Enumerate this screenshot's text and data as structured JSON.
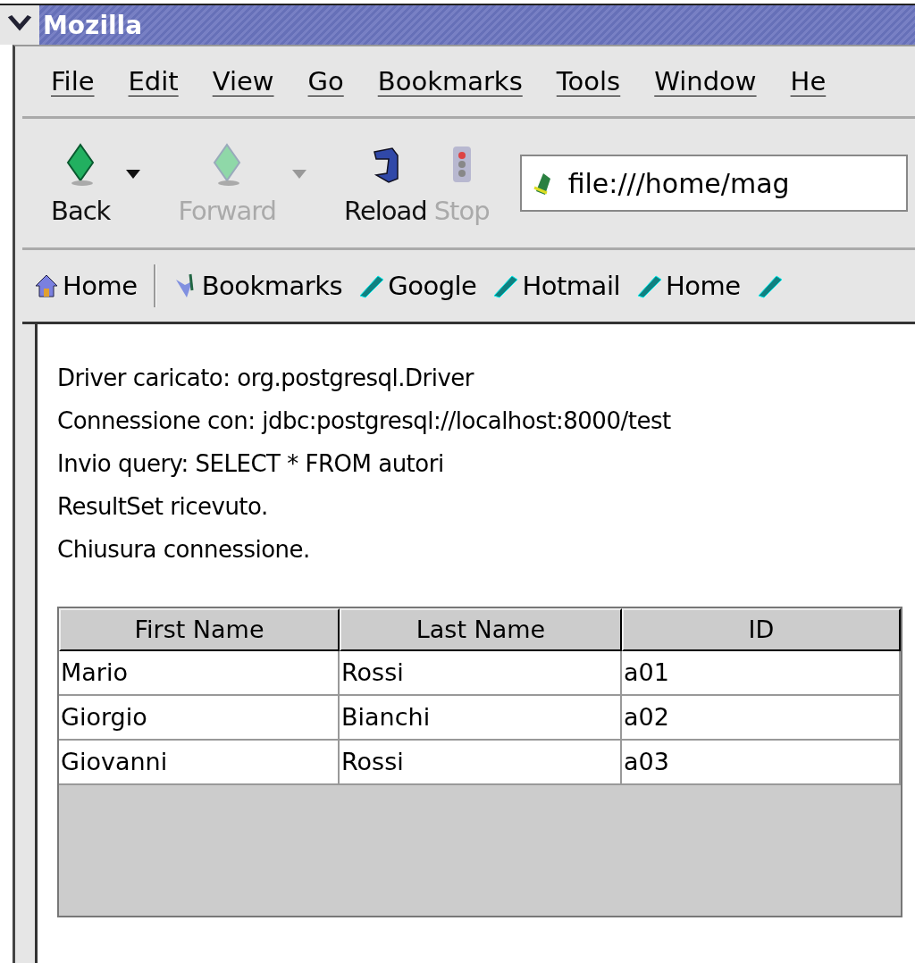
{
  "window": {
    "title": "Mozilla"
  },
  "menu": [
    "File",
    "Edit",
    "View",
    "Go",
    "Bookmarks",
    "Tools",
    "Window",
    "He"
  ],
  "nav_buttons": [
    {
      "kind": "back",
      "label": "Back",
      "disabled": false,
      "dropdown": true
    },
    {
      "kind": "forward",
      "label": "Forward",
      "disabled": true,
      "dropdown": true
    },
    {
      "kind": "reload",
      "label": "Reload",
      "disabled": false,
      "dropdown": false
    },
    {
      "kind": "stop",
      "label": "Stop",
      "disabled": true,
      "dropdown": false
    }
  ],
  "address": {
    "value": "file:///home/mag"
  },
  "personal_toolbar": [
    {
      "kind": "home",
      "label": "Home"
    },
    {
      "kind": "bookmarks",
      "label": "Bookmarks"
    },
    {
      "kind": "link",
      "label": "Google"
    },
    {
      "kind": "link",
      "label": "Hotmail"
    },
    {
      "kind": "link",
      "label": "Home"
    },
    {
      "kind": "link"
    }
  ],
  "content": {
    "lines": [
      "Driver caricato: org.postgresql.Driver",
      "Connessione con: jdbc:postgresql://localhost:8000/test",
      "Invio query: SELECT * FROM autori",
      "ResultSet ricevuto.",
      "Chiusura connessione."
    ],
    "table": {
      "columns": [
        "First Name",
        "Last Name",
        "ID"
      ],
      "rows": [
        [
          "Mario",
          "Rossi",
          "a01"
        ],
        [
          "Giorgio",
          "Bianchi",
          "a02"
        ],
        [
          "Giovanni",
          "Rossi",
          "a03"
        ]
      ]
    }
  }
}
